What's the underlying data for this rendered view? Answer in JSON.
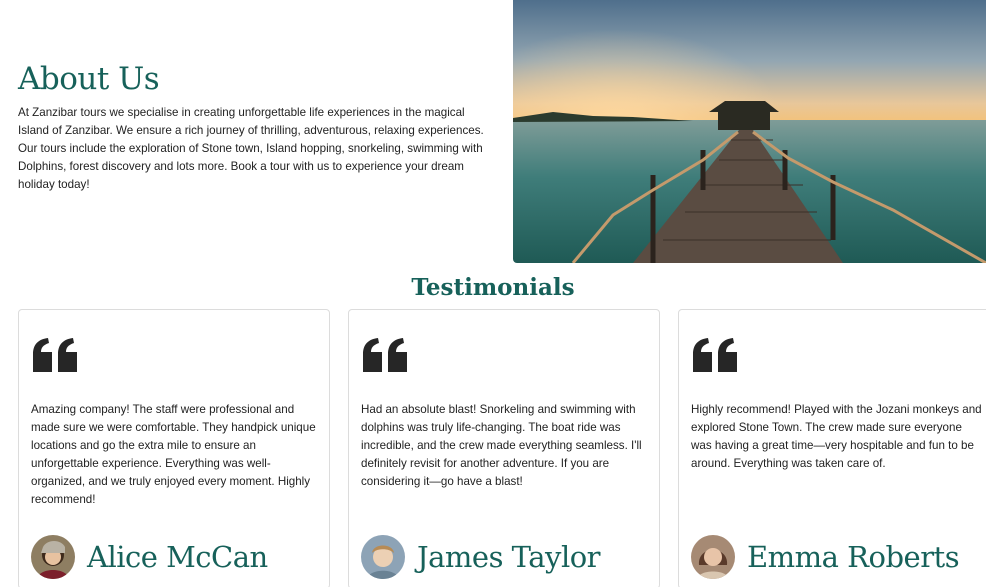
{
  "about": {
    "title": "About Us",
    "body": "At Zanzibar tours we specialise in creating unforgettable life experiences in the magical Island of Zanzibar. We ensure a rich journey of thrilling, adventurous, relaxing experiences. Our tours include the exploration of Stone town, Island hopping, snorkeling, swimming with Dolphins, forest discovery and lots more. Book a tour with us to experience your dream holiday today!",
    "image_icon": "jetty-sunset-photo"
  },
  "testimonials": {
    "title": "Testimonials",
    "quote_icon": "quote-icon",
    "items": [
      {
        "text": "Amazing company! The staff were professional and made sure we were comfortable. They handpick unique locations and go the extra mile to ensure an unforgettable experience. Everything was well-organized, and we truly enjoyed every moment. Highly recommend!",
        "name": "Alice McCan"
      },
      {
        "text": "Had an absolute blast! Snorkeling and swimming with dolphins was truly life-changing. The boat ride was incredible, and the crew made everything seamless. I'll definitely revisit for another adventure. If you are considering it—go have a blast!",
        "name": "James Taylor"
      },
      {
        "text": "Highly recommend! Played with the Jozani monkeys and explored Stone Town. The crew made sure everyone was having a great time—very hospitable and fun to be around. Everything was taken care of.",
        "name": "Emma Roberts"
      }
    ]
  },
  "colors": {
    "accent": "#17615a",
    "text": "#222222",
    "card_border": "#dcdcdc"
  }
}
